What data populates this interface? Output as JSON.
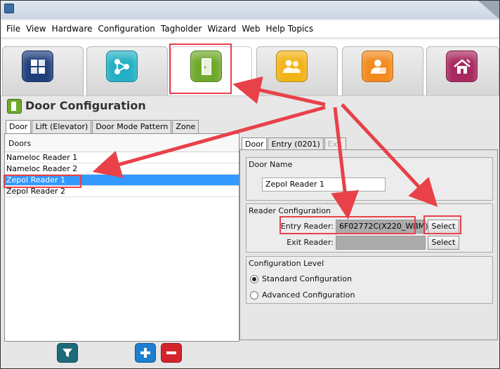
{
  "menu": [
    "File",
    "View",
    "Hardware",
    "Configuration",
    "Tagholder",
    "Wizard",
    "Web",
    "Help Topics"
  ],
  "modules": [
    {
      "icon": "building-blocks-icon",
      "color": "#1f3e7a"
    },
    {
      "icon": "network-nodes-icon",
      "color": "#23b0c4"
    },
    {
      "icon": "door-icon",
      "color": "#6fa92c"
    },
    {
      "icon": "user-group-icon",
      "color": "#f2b316"
    },
    {
      "icon": "user-card-icon",
      "color": "#f28a1d"
    },
    {
      "icon": "home-edit-icon",
      "color": "#a8285f"
    }
  ],
  "page": {
    "title": "Door Configuration",
    "title_icon": "door-icon"
  },
  "main_tabs": [
    "Door",
    "Lift (Elevator)",
    "Door Mode Pattern",
    "Zone"
  ],
  "doors": {
    "header": "Doors",
    "items": [
      "Nameloc Reader 1",
      "Nameloc Reader 2",
      "Zepol Reader 1",
      "Zepol Reader 2"
    ],
    "selected_index": 2
  },
  "detail_tabs": [
    {
      "label": "Door",
      "state": "active"
    },
    {
      "label": "Entry (0201)",
      "state": "normal"
    },
    {
      "label": "Exit",
      "state": "disabled"
    }
  ],
  "door_name": {
    "title": "Door Name",
    "value": "Zepol Reader 1"
  },
  "reader_config": {
    "title": "Reader Configuration",
    "entry_label": "Entry Reader:",
    "entry_value": "6F02772C(X220_WBM)",
    "exit_label": "Exit Reader:",
    "exit_value": "",
    "select_label": "Select"
  },
  "config_level": {
    "title": "Configuration Level",
    "options": [
      "Standard Configuration",
      "Advanced Configuration"
    ],
    "selected": 0
  },
  "bottom_buttons": [
    {
      "icon": "filter-icon",
      "color": "#1d6b78"
    },
    {
      "icon": "plus-icon",
      "color": "#1e7fd0"
    },
    {
      "icon": "minus-icon",
      "color": "#d3242b"
    }
  ],
  "colors": {
    "highlight": "#e8414a",
    "selection": "#3399ff"
  }
}
